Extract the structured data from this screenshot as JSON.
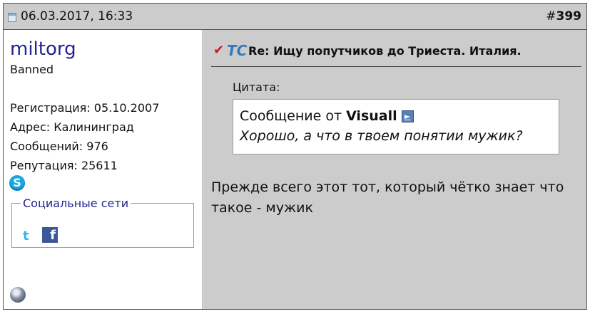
{
  "post": {
    "date": "06.03.2017, 16:33",
    "number_prefix": "#",
    "number": "399"
  },
  "user": {
    "name": "miltorg",
    "title": "Banned",
    "registration": "Регистрация: 05.10.2007",
    "address": "Адрес: Калининград",
    "messages": "Сообщений: 976",
    "reputation": "Репутация: 25611",
    "social_legend": "Социальные сети"
  },
  "content": {
    "title_icon_text": "TC",
    "title": "Re: Ищу попутчиков до Триеста. Италия.",
    "quote_label": "Цитата:",
    "quote_from_prefix": "Сообщение от",
    "quote_author": "Visuall",
    "quote_text": "Хорошо, а что в твоем понятии мужик?",
    "message": "Прежде всего этот тот, который чётко знает что такое - мужик"
  },
  "icons": {
    "post_icon": "post-icon",
    "skype": "skype-icon",
    "twitter": "twitter-icon",
    "facebook": "facebook-icon",
    "view_post": "view-post-icon",
    "status": "offline-status-icon"
  },
  "colors": {
    "header_bg": "#cccccc",
    "username": "#22238f",
    "tc_blue": "#3a78b8",
    "check_red": "#d0171f"
  }
}
